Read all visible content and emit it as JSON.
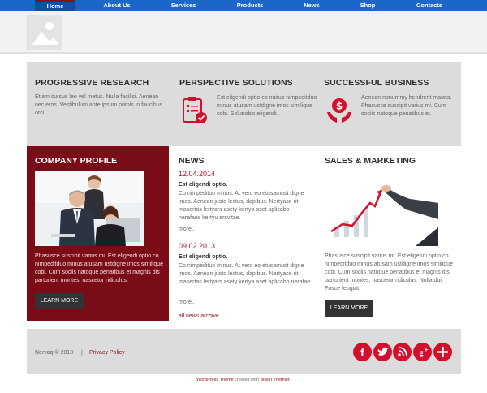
{
  "nav": {
    "items": [
      "Home",
      "About Us",
      "Services",
      "Products",
      "News",
      "Shop",
      "Contacts"
    ]
  },
  "features": [
    {
      "title": "PROGRESSIVE RESEARCH",
      "text": "Etiam cursus leo vel metus. Nulla facilisi. Aenean nec eros. Vestibulum ante ipsum primis in faucibus orci."
    },
    {
      "title": "PERSPECTIVE SOLUTIONS",
      "text": "Est eligendi optio co nuitus nimpeditduo minus atusam ustdigne imos similique cobi. Solunobis eligendi."
    },
    {
      "title": "SUCCESSFUL BUSINESS",
      "text": "Aenean nonummy hendrerit mauris. Phasusce suscipit varius mi. Cum sociis natoque penatibus et."
    }
  ],
  "profile": {
    "title": "COMPANY PROFILE",
    "text": "Phasusce suscipit varius mi. Est eligendi optio co nimpeditduo minus atusam ustdigne imos similique cobi. Cum sociis natoque penatibus et magnis dis parturient montes, nascetur ridiculus.",
    "button": "LEARN MORE"
  },
  "news": {
    "title": "NEWS",
    "items": [
      {
        "date": "12.04.2014",
        "heading": "Est eligendi optio.",
        "text": "Co nimpedituo minus. At vero eo etusamust digne imos. Aenean justo lectus, dapibus. Nertyase rit masertas lertyars asety kertya aset aplicabo nerafaes kertyu ersvitae.",
        "more": "more.."
      },
      {
        "date": "09.02.2013",
        "heading": "Est eligendi optio.",
        "text": "Co nimpedituo minus. At vero eo etusamust digne imos. Aenean justo lectus, dapibus. Nertyase rit masertas lertyars asety kertya aset aplicabo nerafae.",
        "more": "more.."
      }
    ],
    "archive": "all news archive"
  },
  "sales": {
    "title": "SALES & MARKETING",
    "text": "Phasusce suscipit varius mi. Est eligendi optio co nimpeditduo minus atusam ustdigne imos similique cobi. Cum sociis natoque penatibus et magnis dis parturient montes, nascetur ridiculus. Nulla dui. Fusce feugiat.",
    "button": "LEARN MORE"
  },
  "footer": {
    "copyright": "Nervaq © 2013",
    "separator": "|",
    "privacy": "Privacy Policy",
    "social": [
      "facebook-icon",
      "twitter-icon",
      "rss-icon",
      "google-plus-icon",
      "plus-icon"
    ]
  },
  "credit": {
    "prefix": "WordPress Theme",
    "middle": " created with ",
    "suffix": "Billion Themler."
  },
  "colors": {
    "nav": "#1b66c9",
    "accent_red": "#d3102c",
    "profile_bg": "#7a0c17",
    "band_gray": "#dcdcdc"
  }
}
